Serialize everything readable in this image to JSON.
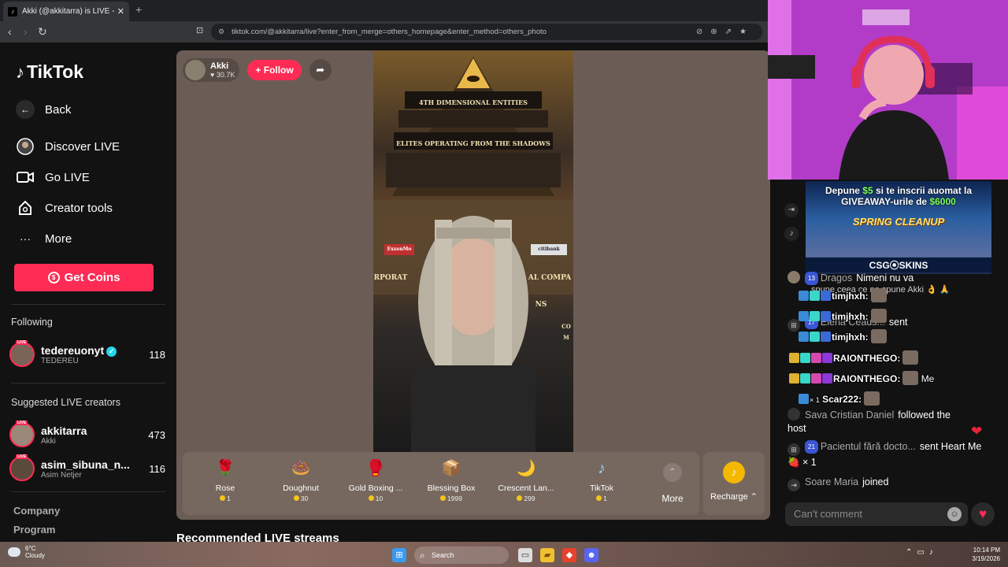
{
  "browser": {
    "tab_title": "Akki (@akkitarra) is LIVE - Tik",
    "tab_close": "✕",
    "new_tab": "+",
    "url": "tiktok.com/@akkitarra/live?enter_from_merge=others_homepage&enter_method=others_photo"
  },
  "sidebar": {
    "logo": "TikTok",
    "back": "Back",
    "nav": [
      {
        "label": "Discover LIVE",
        "icon": "discover-live-icon"
      },
      {
        "label": "Go LIVE",
        "icon": "camera-icon"
      },
      {
        "label": "Creator tools",
        "icon": "creator-tools-icon"
      },
      {
        "label": "More",
        "icon": "more-dots-icon"
      }
    ],
    "get_coins": "Get Coins",
    "following_header": "Following",
    "following": [
      {
        "name": "tedereuonyt",
        "sub": "TEDEREU",
        "count": "118",
        "verified": true
      }
    ],
    "suggested_header": "Suggested LIVE creators",
    "suggested": [
      {
        "name": "akkitarra",
        "sub": "Akki",
        "count": "473"
      },
      {
        "name": "asim_sibuna_n...",
        "sub": "Asim Netjer",
        "count": "116"
      }
    ],
    "footer": [
      "Company",
      "Program"
    ]
  },
  "stream": {
    "host_name": "Akki",
    "host_likes": "30.7K",
    "follow": "+ Follow",
    "video_text": [
      "4TH DIMENSIONAL ENTITIES",
      "ELITES OPERATING FROM THE SHADOWS",
      "ExxonMo",
      "citibank",
      "RPORAT",
      "AL COMPA",
      "NS",
      "CO",
      "M"
    ],
    "gifts": [
      {
        "name": "Rose",
        "price": "1",
        "icon": "rose-gift-icon",
        "glyph": "🌹"
      },
      {
        "name": "Doughnut",
        "price": "30",
        "icon": "doughnut-gift-icon",
        "glyph": "🍩"
      },
      {
        "name": "Gold Boxing ...",
        "price": "10",
        "icon": "gold-boxing-gift-icon",
        "glyph": "🥊"
      },
      {
        "name": "Blessing Box",
        "price": "1999",
        "icon": "blessing-box-gift-icon",
        "glyph": "📦"
      },
      {
        "name": "Crescent Lan...",
        "price": "299",
        "icon": "crescent-lantern-gift-icon",
        "glyph": "🌙"
      },
      {
        "name": "TikTok",
        "price": "1",
        "icon": "tiktok-gift-icon",
        "glyph": "♪"
      }
    ],
    "more": "More",
    "recharge": "Recharge ⌃",
    "recommended": "Recommended LIVE streams"
  },
  "ad": {
    "line1_pre": "Depune ",
    "line1_amount": "$5",
    "line1_post": " si te inscrii auomat la",
    "line2_pre": "GIVEAWAY-urile de ",
    "line2_amount": "$6000",
    "headline": "SPRING CLEANUP",
    "brand": "CSG⦿SKINS"
  },
  "chat": {
    "messages": [
      {
        "user": "Dragos",
        "text": "Nimeni nu va",
        "badge": "13"
      },
      {
        "user": "",
        "text": "spune ceea ce ne spune Akki 👌 🙏",
        "badge": ""
      },
      {
        "user": "Elena Ceaus...",
        "text": "sent",
        "badge": "17"
      },
      {
        "user": "Sava Cristian Daniel",
        "text": "followed the host",
        "badge": ""
      },
      {
        "user": "Pacientul fără docto...",
        "text": "sent Heart Me 🍓 × 1",
        "badge": "21"
      },
      {
        "user": "Soare Maria",
        "text": "joined",
        "badge": ""
      }
    ],
    "overlay_names": [
      "timjhxh:",
      "timjhxh:",
      "timjhxh:",
      "RAIONTHEGO:",
      "RAIONTHEGO:",
      "Scar222:"
    ],
    "overlay_extra": [
      "Me",
      "× 1"
    ],
    "comment_placeholder": "Can't comment"
  },
  "taskbar": {
    "temp": "6°C",
    "weather": "Cloudy",
    "search": "Search",
    "time": "10:14 PM",
    "date": "3/19/2026"
  },
  "colors": {
    "accent": "#fe2c55",
    "stream_bg": "#6b5d55",
    "verified": "#20d5ec"
  }
}
